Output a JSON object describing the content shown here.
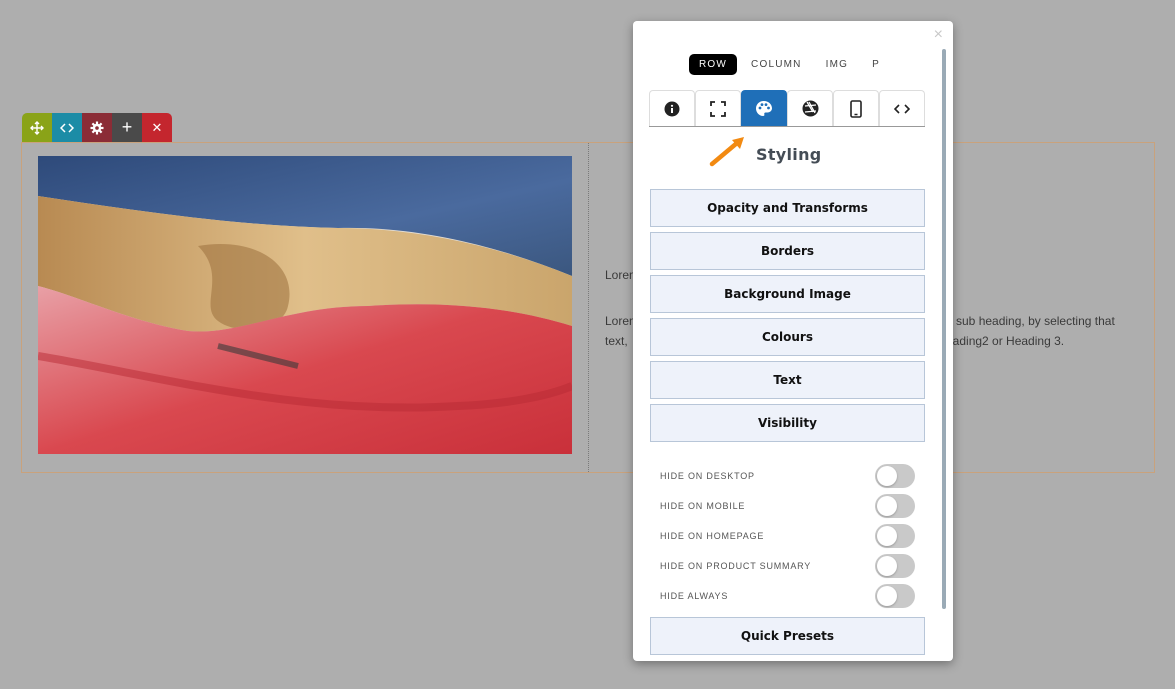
{
  "toolbar": {
    "move_icon": "move-icon",
    "code_icon": "code-icon",
    "gear_icon": "gear-icon",
    "add_glyph": "+",
    "delete_glyph": "✕"
  },
  "content": {
    "lorem_line1": "Lorem",
    "lorem_line2a": "Lorem",
    "lorem_line2b": "text,",
    "lorem_right1": "a sub heading, by selecting that",
    "lorem_right2": "eading2 or Heading 3."
  },
  "panel": {
    "close_glyph": "×",
    "element_tabs": [
      {
        "label": "ROW",
        "active": true
      },
      {
        "label": "COLUMN",
        "active": false
      },
      {
        "label": "IMG",
        "active": false
      },
      {
        "label": "P",
        "active": false
      }
    ],
    "icon_tabs": [
      {
        "icon": "info-icon",
        "active": false
      },
      {
        "icon": "fullscreen-icon",
        "active": false
      },
      {
        "icon": "palette-icon",
        "active": true
      },
      {
        "icon": "aperture-icon",
        "active": false
      },
      {
        "icon": "mobile-icon",
        "active": false
      },
      {
        "icon": "code-icon",
        "active": false
      }
    ],
    "section_title": "Styling",
    "buttons": [
      "Opacity and Transforms",
      "Borders",
      "Background Image",
      "Colours",
      "Text",
      "Visibility"
    ],
    "toggles": [
      {
        "label": "HIDE ON DESKTOP",
        "on": false
      },
      {
        "label": "HIDE ON MOBILE",
        "on": false
      },
      {
        "label": "HIDE ON HOMEPAGE",
        "on": false
      },
      {
        "label": "HIDE ON PRODUCT SUMMARY",
        "on": false
      },
      {
        "label": "HIDE ALWAYS",
        "on": false
      }
    ],
    "quick_presets": "Quick Presets"
  },
  "colors": {
    "accent_blue": "#1f6fb8",
    "arrow_orange": "#f28a12",
    "toolbar_green": "#8aa318",
    "toolbar_teal": "#1c8ca6",
    "toolbar_maroon": "#8b2c36",
    "toolbar_gray": "#4a4a4a",
    "toolbar_red": "#c4262e"
  }
}
